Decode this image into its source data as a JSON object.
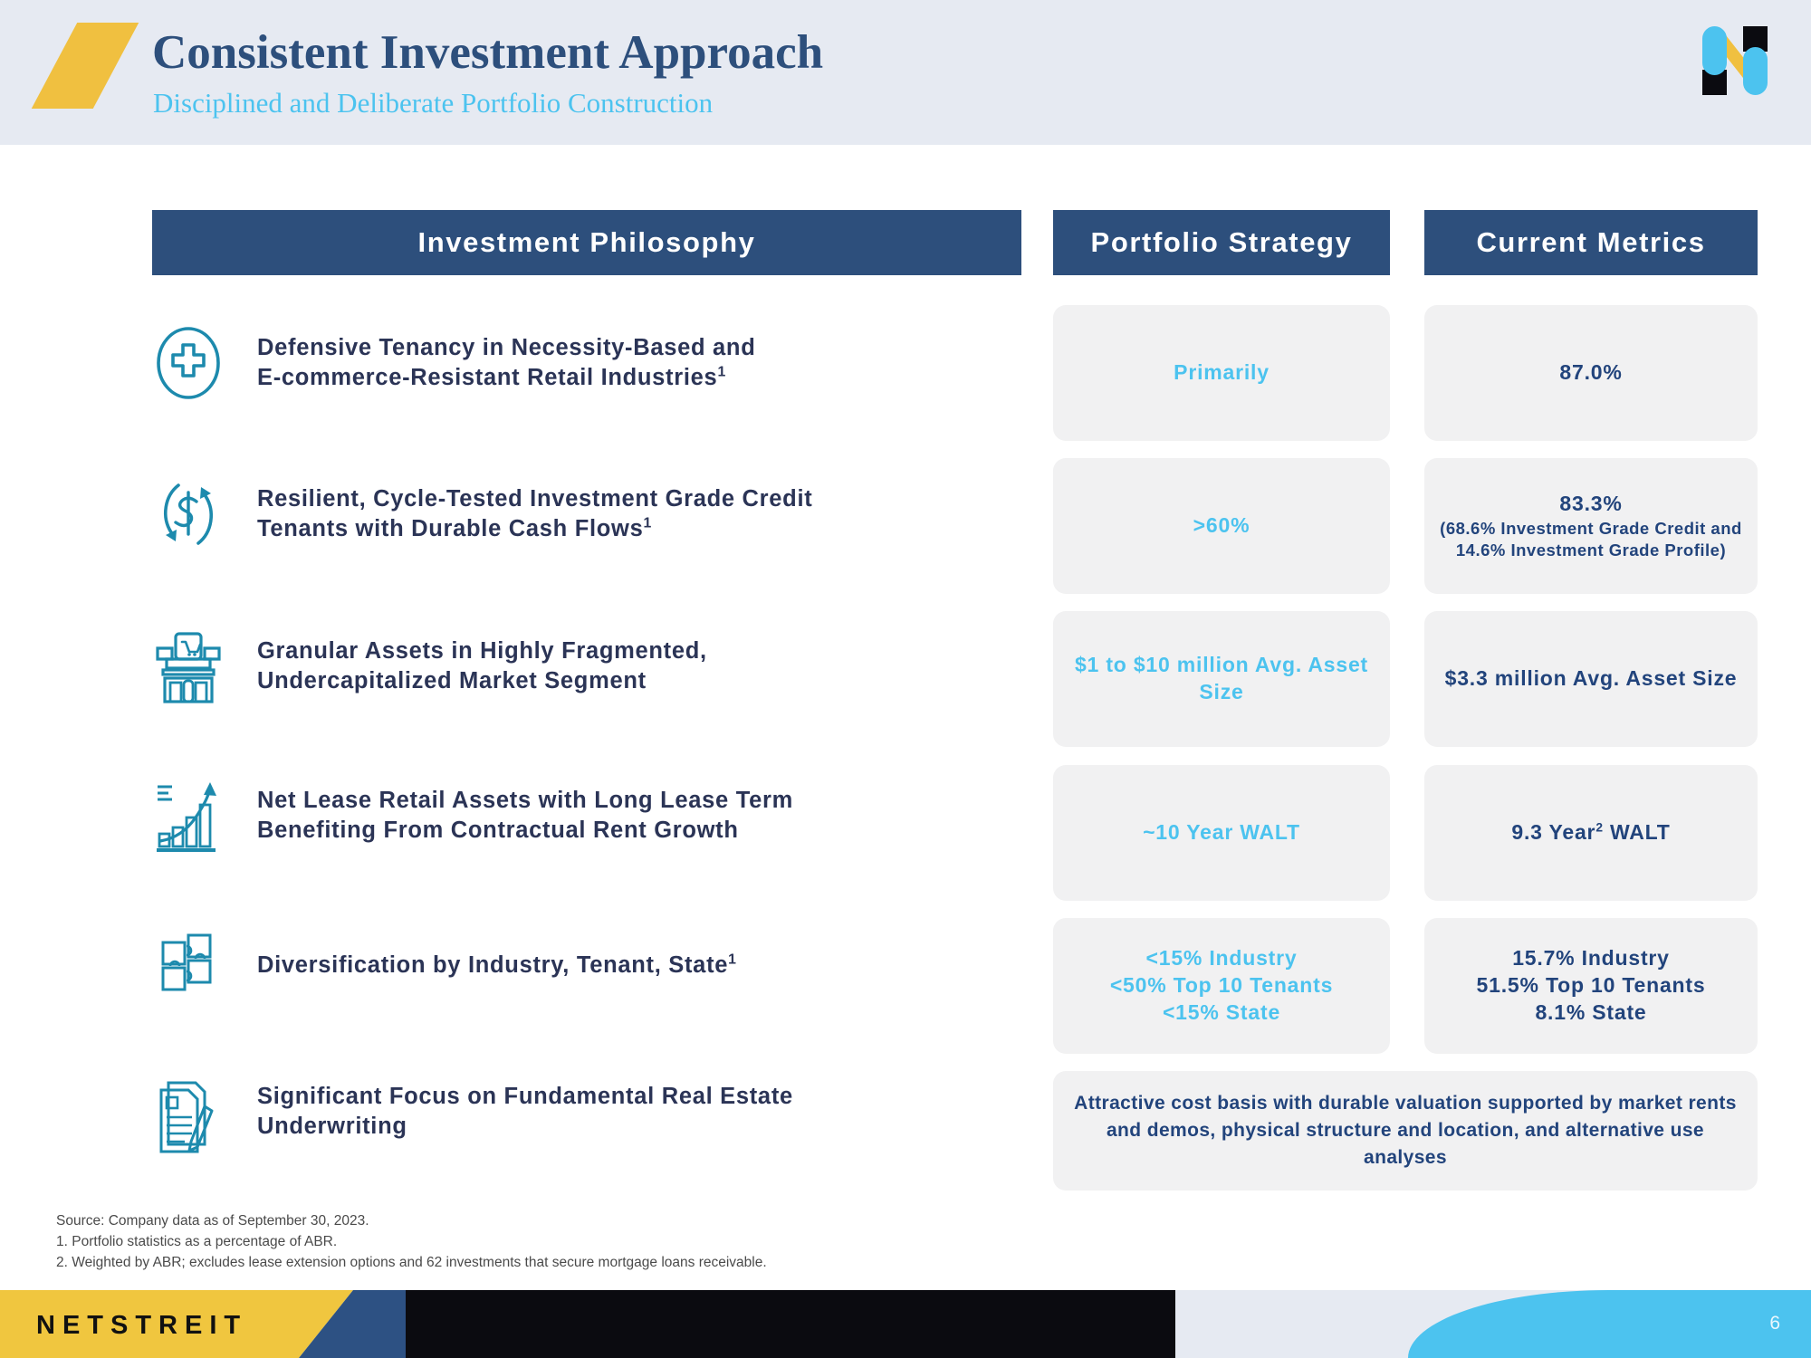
{
  "header": {
    "title": "Consistent Investment Approach",
    "subtitle": "Disciplined and Deliberate Portfolio Construction",
    "logo_name": "netstreit-n-logo"
  },
  "columns": {
    "philosophy_header": "Investment Philosophy",
    "strategy_header": "Portfolio Strategy",
    "metrics_header": "Current Metrics"
  },
  "rows": [
    {
      "icon": "medical-cross-oval-icon",
      "philosophy_line1": "Defensive Tenancy in Necessity-Based and",
      "philosophy_line2": "E-commerce-Resistant Retail Industries",
      "philosophy_sup": "1",
      "strategy": "Primarily",
      "metric_main": "87.0%",
      "metric_sup": "",
      "metric_sub": ""
    },
    {
      "icon": "dollar-cycle-arrows-icon",
      "philosophy_line1": "Resilient, Cycle-Tested Investment Grade Credit",
      "philosophy_line2": "Tenants with Durable Cash Flows",
      "philosophy_sup": "1",
      "strategy": ">60%",
      "metric_main": "83.3%",
      "metric_sup": "",
      "metric_sub": "(68.6% Investment Grade Credit and 14.6% Investment Grade Profile)"
    },
    {
      "icon": "storefront-shopping-cart-icon",
      "philosophy_line1": "Granular Assets in Highly Fragmented,",
      "philosophy_line2": "Undercapitalized Market Segment",
      "philosophy_sup": "",
      "strategy": "$1 to $10 million Avg. Asset Size",
      "metric_main": "$3.3 million Avg. Asset Size",
      "metric_sup": "",
      "metric_sub": ""
    },
    {
      "icon": "growth-bar-chart-arrow-icon",
      "philosophy_line1": "Net Lease Retail Assets with Long Lease Term",
      "philosophy_line2": "Benefiting From Contractual Rent Growth",
      "philosophy_sup": "",
      "strategy": "~10 Year WALT",
      "metric_main": "9.3 Year",
      "metric_sup": "2",
      "metric_main_tail": " WALT",
      "metric_sub": ""
    },
    {
      "icon": "puzzle-pieces-icon",
      "philosophy_line1": "Diversification by Industry, Tenant, State",
      "philosophy_line2": "",
      "philosophy_sup": "1",
      "strategy": "<15% Industry\n<50% Top 10 Tenants\n<15% State",
      "metric_main": "15.7% Industry\n51.5% Top 10 Tenants\n8.1% State",
      "metric_sup": "",
      "metric_sub": ""
    },
    {
      "icon": "document-pen-underwriting-icon",
      "philosophy_line1": "Significant Focus on Fundamental Real Estate",
      "philosophy_line2": "Underwriting",
      "philosophy_sup": "",
      "strategy": "",
      "metric_main": "",
      "metric_sub": ""
    }
  ],
  "spanning_card": "Attractive cost basis with durable valuation supported by market rents and demos, physical structure and location, and alternative use analyses",
  "footnotes": {
    "source": "Source: Company data as of September 30, 2023.",
    "note1": "1.  Portfolio statistics as a percentage of ABR.",
    "note2": "2.  Weighted by ABR; excludes lease extension options and 62 investments that secure mortgage loans receivable."
  },
  "footer": {
    "wordmark": "NETSTREIT",
    "page_number": "6"
  },
  "colors": {
    "navy": "#2d4f7c",
    "cyan": "#4cc3ef",
    "yellow": "#f0c040",
    "teal_icon": "#1d8aad",
    "card_bg": "#f1f1f2",
    "header_band": "#e6eaf2",
    "text_dark": "#2b3456"
  }
}
